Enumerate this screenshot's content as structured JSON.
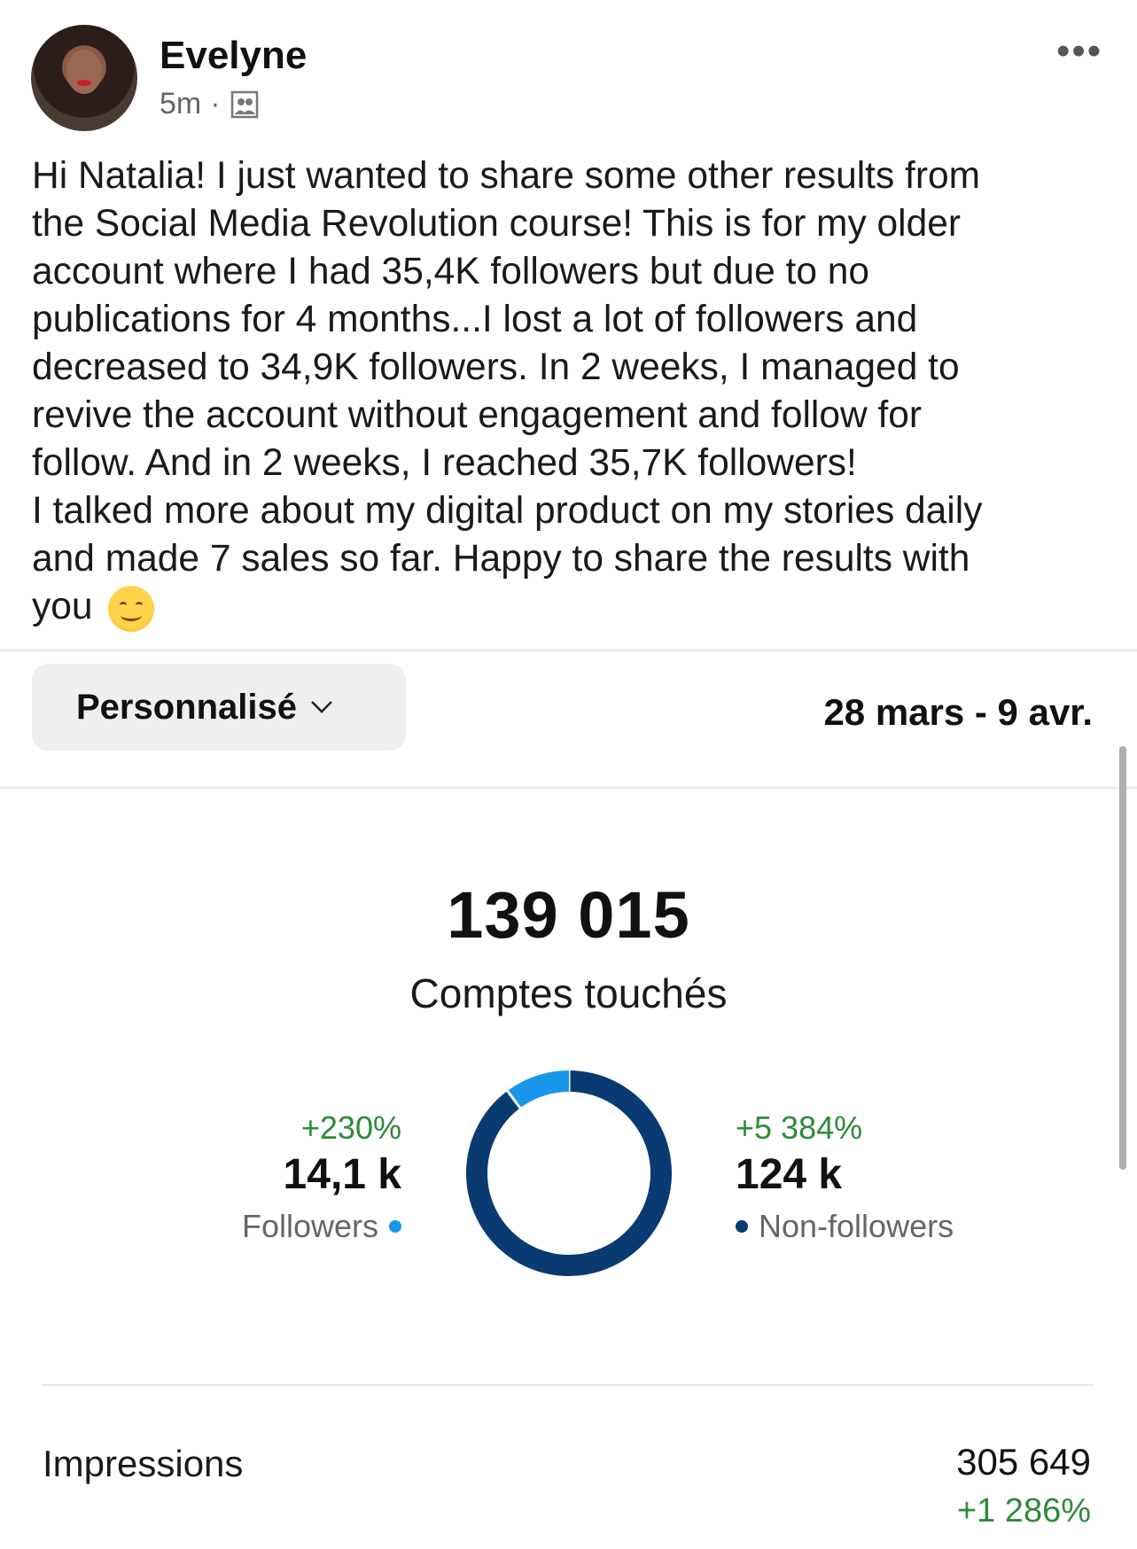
{
  "post": {
    "author": "Evelyne",
    "time": "5m",
    "audience_icon": "people-icon",
    "more_icon": "more-icon",
    "more_label": "•••",
    "text": "Hi Natalia! I just wanted to share some other results from\nthe Social Media Revolution course! This is for my older\naccount where I had 35,4K followers but due to no\npublications for 4 months...I lost a lot of followers and\ndecreased to 34,9K followers. In 2 weeks, I managed to\nrevive the account without engagement and follow for\nfollow. And in 2 weeks, I reached 35,7K followers!\nI talked more about my digital product on my stories daily\nand made 7 sales so far. Happy to share the results with\nyou",
    "emoji": "smiling-face-emoji"
  },
  "insights": {
    "filter_label": "Personnalisé",
    "date_range": "28 mars - 9 avr.",
    "accounts_reached_value": "139 015",
    "accounts_reached_label": "Comptes touchés",
    "followers": {
      "change": "+230%",
      "value": "14,1 k",
      "label": "Followers"
    },
    "non_followers": {
      "change": "+5 384%",
      "value": "124 k",
      "label": "Non-followers"
    },
    "impressions": {
      "label": "Impressions",
      "value": "305 649",
      "change": "+1 286%"
    }
  },
  "colors": {
    "followers": "#1a95ec",
    "non_followers": "#0a3a72",
    "positive_change": "#2f8a3a"
  },
  "chart_data": {
    "type": "pie",
    "donut": true,
    "categories": [
      "Followers",
      "Non-followers"
    ],
    "values": [
      14.1,
      124
    ],
    "units": "k",
    "title": ""
  }
}
